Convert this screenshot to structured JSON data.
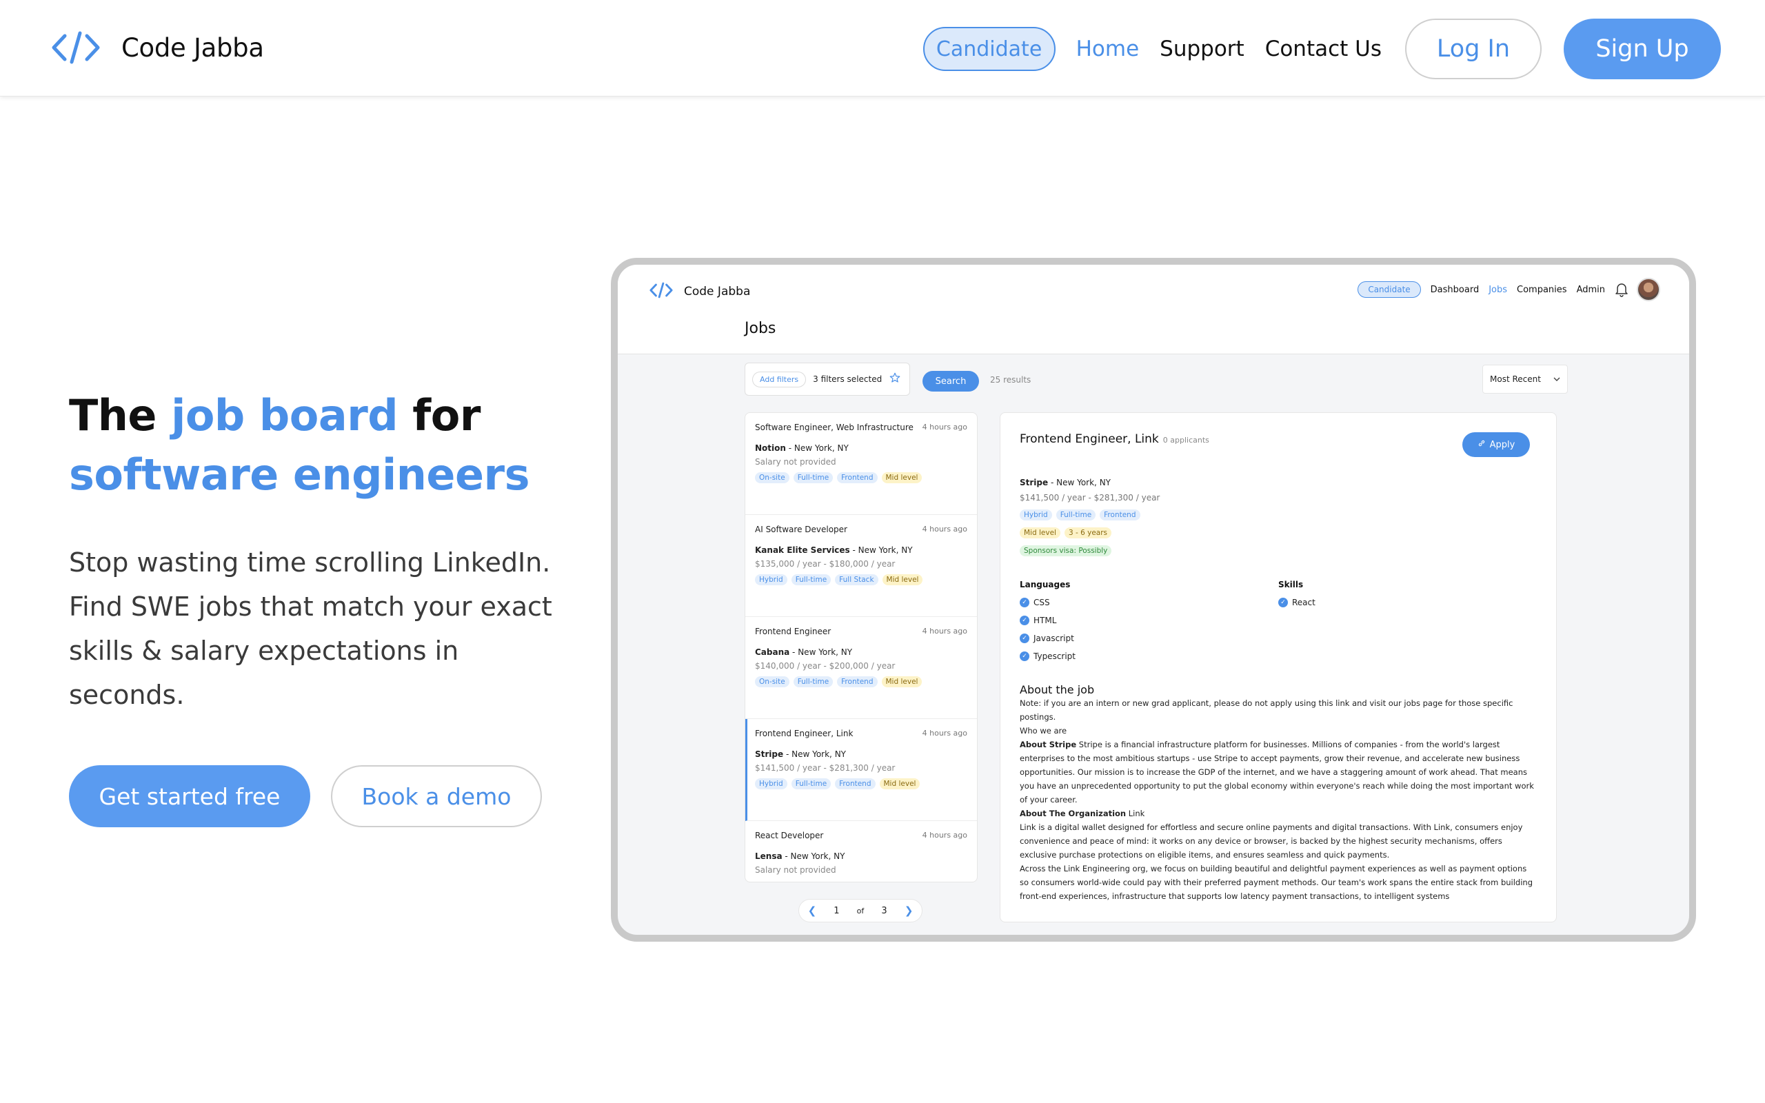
{
  "brand": {
    "name": "Code Jabba",
    "accent": "#4a8fe7"
  },
  "nav": {
    "candidate": "Candidate",
    "home": "Home",
    "support": "Support",
    "contact": "Contact Us",
    "login": "Log In",
    "signup": "Sign Up"
  },
  "hero": {
    "title_1": "The ",
    "title_accent_1": "job board",
    "title_2": " for",
    "title_accent_2": "software engineers",
    "subtitle": "Stop wasting time scrolling LinkedIn. Find SWE jobs that match your exact skills & salary expectations in seconds.",
    "cta_primary": "Get started free",
    "cta_secondary": "Book a demo"
  },
  "app": {
    "brand": "Code Jabba",
    "candidate": "Candidate",
    "links": [
      "Dashboard",
      "Jobs",
      "Companies",
      "Admin"
    ],
    "page_title": "Jobs",
    "add_filters": "Add filters",
    "filters_selected": "3 filters selected",
    "search": "Search",
    "results": "25 results",
    "sort": "Most Recent",
    "jobs": [
      {
        "title": "Software Engineer, Web Infrastructure",
        "time": "4 hours ago",
        "company": "Notion",
        "location": "New York, NY",
        "salary": "Salary not provided",
        "tags": [
          "On-site",
          "Full-time",
          "Frontend"
        ],
        "level": "Mid level"
      },
      {
        "title": "AI Software Developer",
        "time": "4 hours ago",
        "company": "Kanak Elite Services",
        "location": "New York, NY",
        "salary": "$135,000 / year - $180,000 / year",
        "tags": [
          "Hybrid",
          "Full-time",
          "Full Stack"
        ],
        "level": "Mid level"
      },
      {
        "title": "Frontend Engineer",
        "time": "4 hours ago",
        "company": "Cabana",
        "location": "New York, NY",
        "salary": "$140,000 / year - $200,000 / year",
        "tags": [
          "On-site",
          "Full-time",
          "Frontend"
        ],
        "level": "Mid level"
      },
      {
        "title": "Frontend Engineer, Link",
        "time": "4 hours ago",
        "company": "Stripe",
        "location": "New York, NY",
        "salary": "$141,500 / year - $281,300 / year",
        "tags": [
          "Hybrid",
          "Full-time",
          "Frontend"
        ],
        "level": "Mid level"
      },
      {
        "title": "React Developer",
        "time": "4 hours ago",
        "company": "Lensa",
        "location": "New York, NY",
        "salary": "Salary not provided",
        "tags": [],
        "level": ""
      }
    ],
    "pager": {
      "current": "1",
      "of": "of",
      "total": "3"
    },
    "detail": {
      "title": "Frontend Engineer, Link",
      "applicants": "0 applicants",
      "apply": "Apply",
      "company": "Stripe",
      "location": "New York, NY",
      "salary": "$141,500 / year - $281,300 / year",
      "tags": [
        "Hybrid",
        "Full-time",
        "Frontend"
      ],
      "level": "Mid level",
      "experience": "3 - 6 years",
      "visa": "Sponsors visa: Possibly",
      "languages_label": "Languages",
      "languages": [
        "CSS",
        "HTML",
        "Javascript",
        "Typescript"
      ],
      "skills_label": "Skills",
      "skills": [
        "React"
      ],
      "about_heading": "About the job",
      "about_note": "Note: if you are an intern or new grad applicant, please do not apply using this link and visit our jobs page for those specific postings.",
      "who_we_are": "Who we are",
      "about_stripe_label": "About Stripe",
      "about_stripe": " Stripe is a financial infrastructure platform for businesses. Millions of companies - from the world's largest enterprises to the most ambitious startups - use Stripe to accept payments, grow their revenue, and accelerate new business opportunities. Our mission is to increase the GDP of the internet, and we have a staggering amount of work ahead. That means you have an unprecedented opportunity to put the global economy within everyone's reach while doing the most important work of your career.",
      "about_org_label": "About The Organization",
      "about_org_name": " Link",
      "about_org": "Link is a digital wallet designed for effortless and secure online payments and digital transactions. With Link, consumers enjoy convenience and peace of mind: it works on any device or browser, is backed by the highest security mechanisms, offers exclusive purchase protections on eligible items, and ensures seamless and quick payments.",
      "about_eng": "Across the Link Engineering org, we focus on building beautiful and delightful payment experiences as well as payment options so consumers world-wide could pay with their preferred payment methods. Our team's work spans the entire stack from building front-end experiences, infrastructure that supports low latency payment transactions, to intelligent systems"
    }
  }
}
